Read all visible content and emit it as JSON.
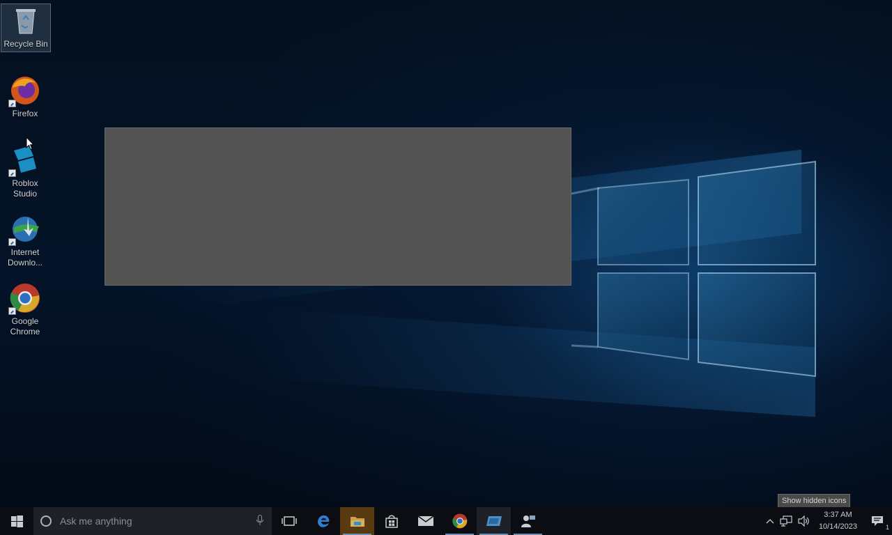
{
  "desktop": {
    "icons": [
      {
        "label": "Recycle Bin",
        "icon": "recycle-bin-icon"
      },
      {
        "label": "Firefox",
        "icon": "firefox-icon"
      },
      {
        "label": "Roblox\nStudio",
        "icon": "roblox-studio-icon"
      },
      {
        "label": "Internet\nDownlo...",
        "icon": "internet-download-manager-icon"
      },
      {
        "label": "Google\nChrome",
        "icon": "chrome-icon"
      }
    ]
  },
  "taskbar": {
    "search_placeholder": "Ask me anything",
    "apps": [
      {
        "icon": "task-view-icon"
      },
      {
        "icon": "edge-icon"
      },
      {
        "icon": "file-explorer-icon"
      },
      {
        "icon": "store-icon"
      },
      {
        "icon": "mail-icon"
      },
      {
        "icon": "chrome-icon"
      },
      {
        "icon": "roblox-studio-icon"
      },
      {
        "icon": "people-icon"
      }
    ],
    "tray": {
      "tooltip": "Show hidden icons",
      "time": "3:37 AM",
      "date": "10/14/2023",
      "notification_count": "1"
    }
  },
  "colors": {
    "window_fill": "#535353",
    "taskbar": "#0b0d12",
    "wallpaper_accent": "#1e6fae"
  }
}
